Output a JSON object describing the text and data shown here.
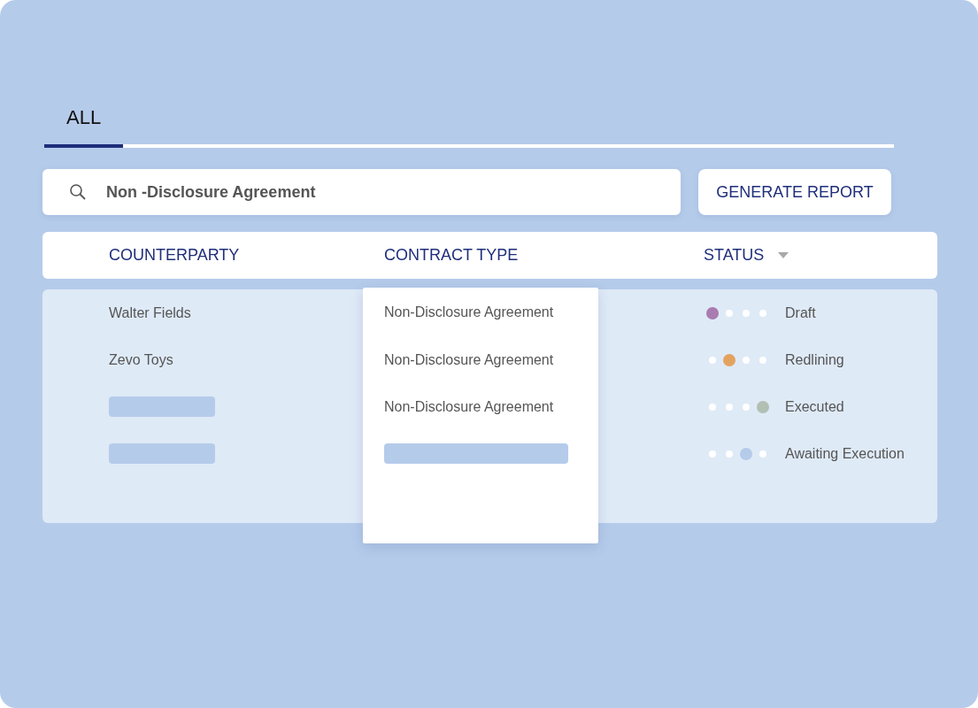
{
  "tabs": [
    {
      "label": "ALL",
      "selected": true
    }
  ],
  "search": {
    "value": "Non -Disclosure Agreement"
  },
  "generate_button": "GENERATE REPORT",
  "table": {
    "columns": [
      {
        "label": "COUNTERPARTY"
      },
      {
        "label": "CONTRACT TYPE"
      },
      {
        "label": "STATUS",
        "sortable": true
      }
    ],
    "rows": [
      {
        "counterparty": {
          "kind": "text",
          "text": "Walter Fields"
        },
        "contract_type": {
          "kind": "text",
          "text": "Non-Disclosure Agreement"
        },
        "status": {
          "label": "Draft",
          "dots": [
            {
              "selected": true,
              "color": "#a97bb0"
            },
            {
              "selected": false
            },
            {
              "selected": false
            },
            {
              "selected": false
            }
          ]
        }
      },
      {
        "counterparty": {
          "kind": "text",
          "text": "Zevo Toys"
        },
        "contract_type": {
          "kind": "text",
          "text": "Non-Disclosure Agreement"
        },
        "status": {
          "label": "Redlining",
          "dots": [
            {
              "selected": false
            },
            {
              "selected": true,
              "color": "#e3a35f"
            },
            {
              "selected": false
            },
            {
              "selected": false
            }
          ]
        }
      },
      {
        "counterparty": {
          "kind": "placeholder"
        },
        "contract_type": {
          "kind": "text",
          "text": "Non-Disclosure Agreement"
        },
        "status": {
          "label": "Executed",
          "dots": [
            {
              "selected": false
            },
            {
              "selected": false
            },
            {
              "selected": false
            },
            {
              "selected": true,
              "color": "#b1c0b3"
            }
          ]
        }
      },
      {
        "counterparty": {
          "kind": "placeholder"
        },
        "contract_type": {
          "kind": "placeholder"
        },
        "status": {
          "label": "Awaiting Execution",
          "dots": [
            {
              "selected": false
            },
            {
              "selected": false
            },
            {
              "selected": true,
              "color": "#b5cbea"
            },
            {
              "selected": false
            }
          ]
        }
      }
    ]
  }
}
